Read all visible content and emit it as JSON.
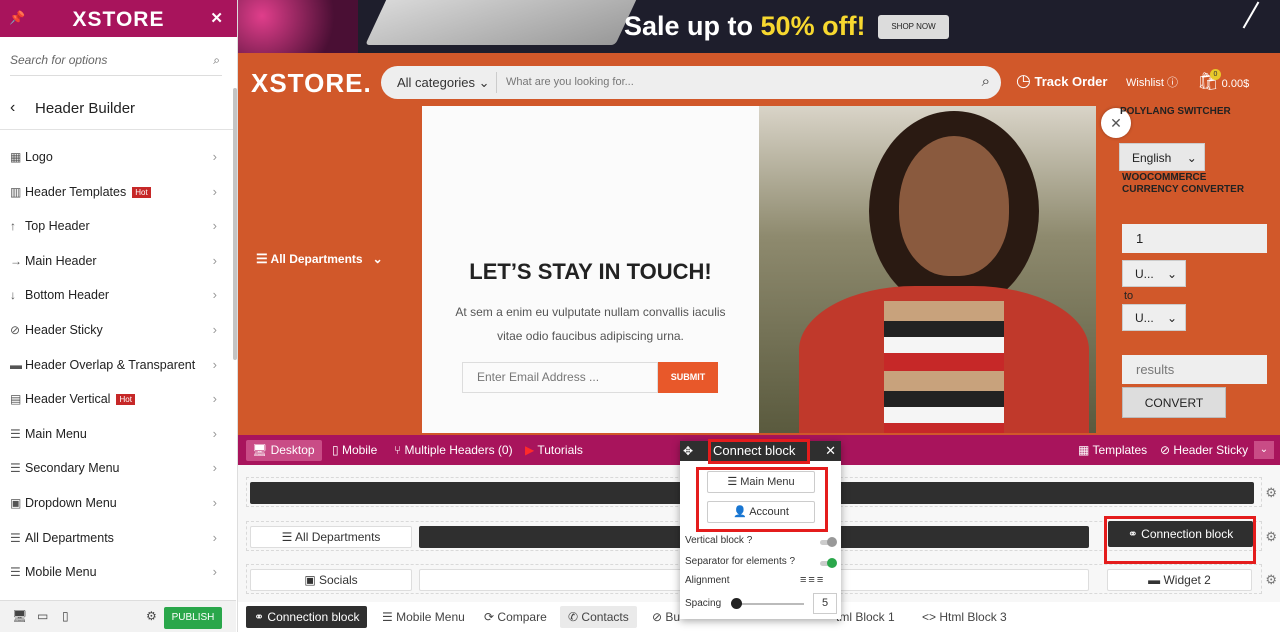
{
  "sidebar": {
    "logo": "XSTORE",
    "search_placeholder": "Search for options",
    "title": "Header Builder",
    "items": [
      {
        "label": "Logo",
        "icon": "image-icon",
        "hot": ""
      },
      {
        "label": "Header Templates",
        "icon": "grid-icon",
        "hot": "Hot"
      },
      {
        "label": "Top Header",
        "icon": "arrow-up-icon",
        "hot": ""
      },
      {
        "label": "Main Header",
        "icon": "arrow-right-icon",
        "hot": ""
      },
      {
        "label": "Bottom Header",
        "icon": "arrow-down-icon",
        "hot": ""
      },
      {
        "label": "Header Sticky",
        "icon": "paperclip-icon",
        "hot": ""
      },
      {
        "label": "Header Overlap & Transparent",
        "icon": "card-icon",
        "hot": ""
      },
      {
        "label": "Header Vertical",
        "icon": "document-icon",
        "hot": "Hot"
      },
      {
        "label": "Main Menu",
        "icon": "menu-icon",
        "hot": ""
      },
      {
        "label": "Secondary Menu",
        "icon": "menu-icon",
        "hot": ""
      },
      {
        "label": "Dropdown Menu",
        "icon": "dropdown-icon",
        "hot": ""
      },
      {
        "label": "All Departments",
        "icon": "menu-icon",
        "hot": ""
      },
      {
        "label": "Mobile Menu",
        "icon": "menu-icon",
        "hot": ""
      }
    ],
    "publish": "PUBLISH"
  },
  "banner": {
    "sale_prefix": "Sale up to ",
    "sale_highlight": "50% off!",
    "shop_now": "SHOP NOW"
  },
  "header": {
    "brand": "XSTORE.",
    "category": "All categories",
    "search_placeholder": "What are you looking for...",
    "track_order": "Track Order",
    "wishlist": "Wishlist",
    "cart_count": "0",
    "cart_total": "0.00$",
    "departments": "All Departments"
  },
  "popup": {
    "title": "LET’S STAY IN TOUCH!",
    "desc": "At sem a enim eu vulputate nullam convallis iaculis vitae odio faucibus adipiscing urna.",
    "email_placeholder": "Enter Email Address ...",
    "submit": "SUBMIT"
  },
  "right_panel": {
    "polylang": "POLYLANG SWITCHER",
    "language": "English",
    "currency_title": "WOOCOMMERCE CURRENCY CONVERTER",
    "amount": "1",
    "from": "U...",
    "to_label": "to",
    "to": "U...",
    "results": "results",
    "convert": "CONVERT"
  },
  "builder_bar": {
    "desktop": "Desktop",
    "mobile": "Mobile",
    "multiple": "Multiple Headers (0)",
    "tutorials": "Tutorials",
    "templates": "Templates",
    "header_sticky": "Header Sticky"
  },
  "rows": {
    "all_departments": "All Departments",
    "connection_block": "Connection block",
    "socials": "Socials",
    "widget2": "Widget 2"
  },
  "bottom_list": [
    "Connection block",
    "Mobile Menu",
    "Compare",
    "Contacts",
    "Bu",
    "tml Block 1",
    "Html Block 3"
  ],
  "connect_popup": {
    "title": "Connect block",
    "main_menu": "Main Menu",
    "account": "Account",
    "vertical_block": "Vertical block ?",
    "separator": "Separator for elements ?",
    "alignment": "Alignment",
    "spacing": "Spacing",
    "spacing_value": "5"
  },
  "colors": {
    "brand": "#a8145c",
    "header_bg": "#d1582a",
    "publish": "#2aa74b",
    "highlight": "#e41c1c"
  }
}
